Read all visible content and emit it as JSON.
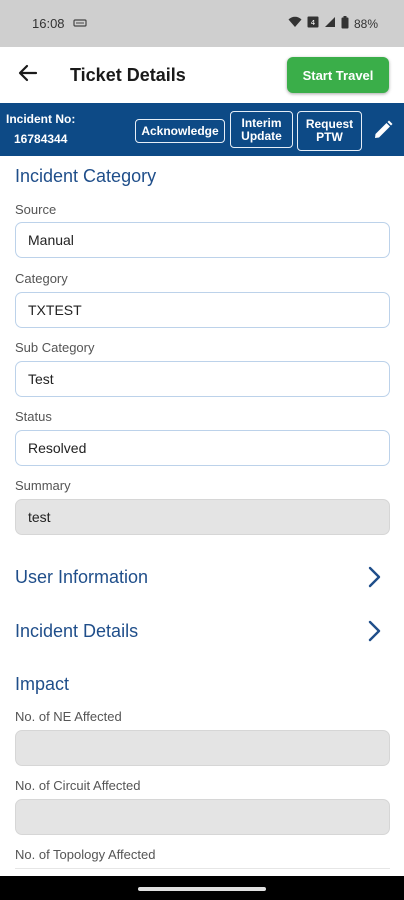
{
  "status_bar": {
    "time": "16:08",
    "left_icon": "sim-card-icon",
    "battery": "88%"
  },
  "app_bar": {
    "back_icon": "arrow-left-icon",
    "title": "Ticket Details",
    "start_travel_label": "Start Travel"
  },
  "incident_bar": {
    "label": "Incident No:",
    "number": "16784344",
    "acknowledge_label": "Acknowledge",
    "interim_update_line1": "Interim",
    "interim_update_line2": "Update",
    "request_ptw_line1": "Request",
    "request_ptw_line2": "PTW",
    "edit_icon": "pencil-icon"
  },
  "incident_category": {
    "title": "Incident Category",
    "fields": [
      {
        "label": "Source",
        "value": "Manual"
      },
      {
        "label": "Category",
        "value": "TXTEST"
      },
      {
        "label": "Sub Category",
        "value": "Test"
      },
      {
        "label": "Status",
        "value": "Resolved"
      },
      {
        "label": "Summary",
        "value": "test"
      }
    ]
  },
  "sections": {
    "user_information": "User Information",
    "incident_details": "Incident Details"
  },
  "impact": {
    "title": "Impact",
    "fields": [
      {
        "label": "No. of NE Affected",
        "value": ""
      },
      {
        "label": "No. of Circuit Affected",
        "value": ""
      },
      {
        "label": "No. of Topology Affected",
        "value": ""
      }
    ]
  },
  "colors": {
    "brand_blue": "#0d4a86",
    "accent_green": "#3aae49",
    "section_title": "#1f4e8a"
  }
}
